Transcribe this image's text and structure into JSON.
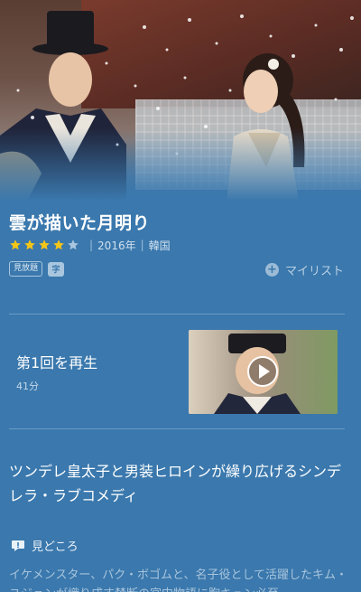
{
  "hero": {
    "alt": "雲が描いた月明り key visual"
  },
  "title": "雲が描いた月明り",
  "rating": {
    "value": 4,
    "max": 5
  },
  "meta": {
    "year": "2016年",
    "country": "韓国"
  },
  "tags": {
    "plan": "見放題",
    "subtitle": "字"
  },
  "mylist": {
    "label": "マイリスト",
    "icon": "plus-circle-icon"
  },
  "episode": {
    "label": "第1回を再生",
    "duration": "41分",
    "icon": "play-icon"
  },
  "catchcopy": "ツンデレ皇太子と男装ヒロインが繰り広げるシンデレラ・ラブコメディ",
  "highlights": {
    "heading": "見どころ",
    "icon": "speech-bubble-icon",
    "text": "イケメンスター、パク・ボゴムと、名子役として活躍したキム・ユジョンが織り成す禁断の宮中物語に胸キュン必至"
  },
  "colors": {
    "background": "#3a78ad",
    "star_on": "#f5c518",
    "star_off": "#a9c6de",
    "divider": "#6b9bc4"
  }
}
